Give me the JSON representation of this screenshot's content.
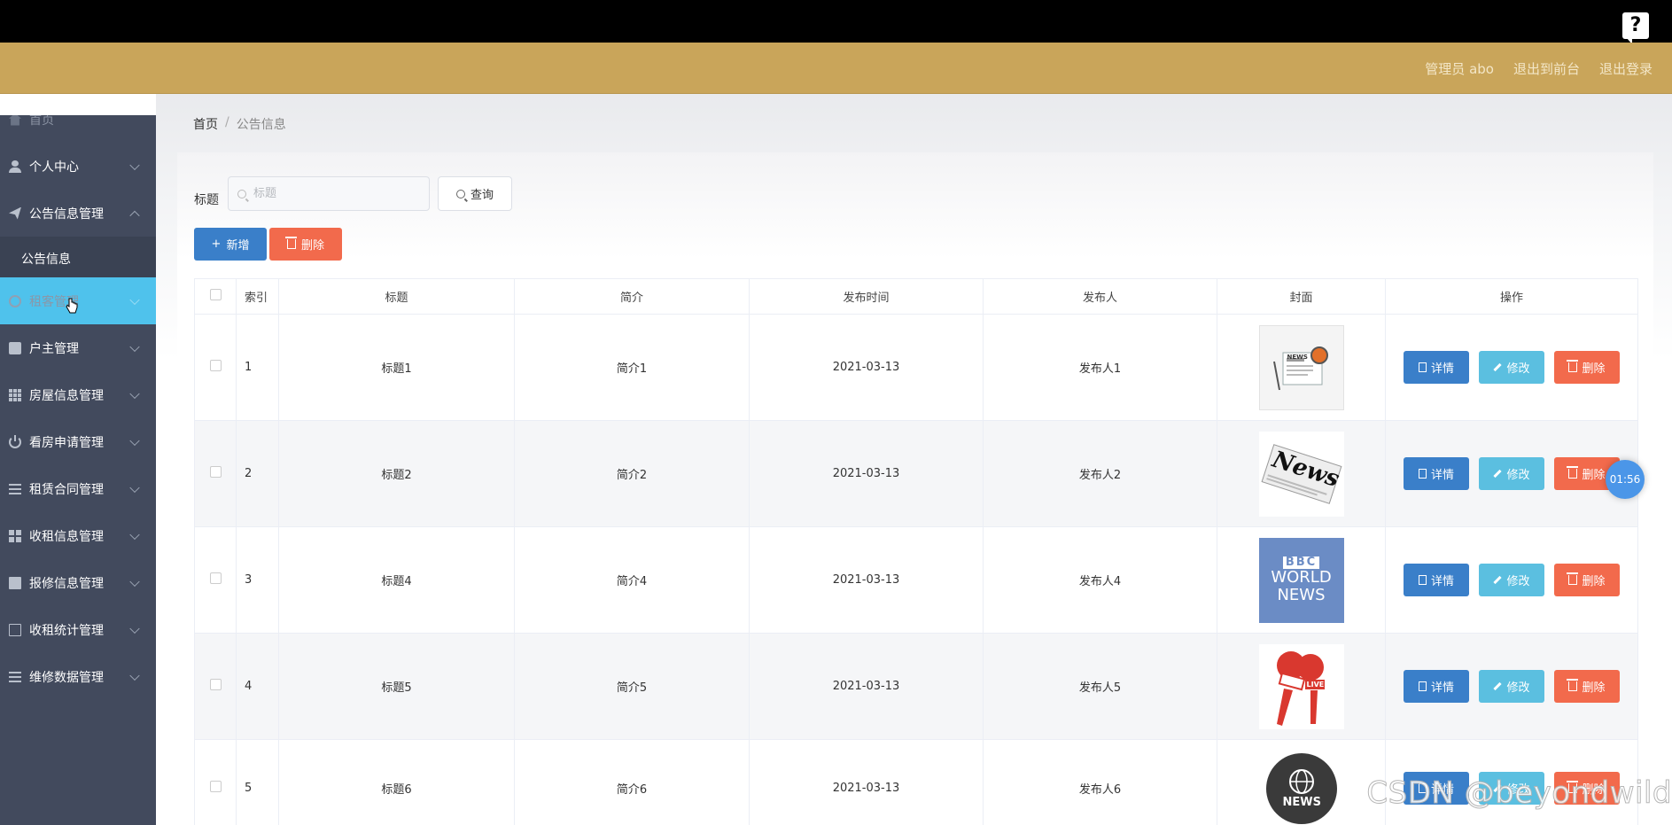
{
  "header": {
    "help_glyph": "?",
    "admin_label": "管理员 abo",
    "back_to_front": "退出到前台",
    "logout": "退出登录"
  },
  "sidebar": {
    "items": [
      {
        "label": "首页",
        "icon": "home-icon"
      },
      {
        "label": "个人中心",
        "icon": "user-icon"
      },
      {
        "label": "公告信息管理",
        "icon": "send-icon"
      },
      {
        "label": "公告信息",
        "icon": ""
      },
      {
        "label": "租客管理",
        "icon": "circle-icon"
      },
      {
        "label": "户主管理",
        "icon": "box-icon"
      },
      {
        "label": "房屋信息管理",
        "icon": "grid-icon"
      },
      {
        "label": "看房申请管理",
        "icon": "power-icon"
      },
      {
        "label": "租赁合同管理",
        "icon": "list-icon"
      },
      {
        "label": "收租信息管理",
        "icon": "apps-icon"
      },
      {
        "label": "报修信息管理",
        "icon": "clipboard-icon"
      },
      {
        "label": "收租统计管理",
        "icon": "card-icon"
      },
      {
        "label": "维修数据管理",
        "icon": "list-icon"
      }
    ]
  },
  "breadcrumb": {
    "home": "首页",
    "separator": "/",
    "current": "公告信息"
  },
  "search": {
    "label": "标题",
    "placeholder": "标题",
    "query_label": "查询"
  },
  "toolbar": {
    "add_label": "新增",
    "add_glyph": "+",
    "delete_label": "删除"
  },
  "table": {
    "columns": [
      "索引",
      "标题",
      "简介",
      "发布时间",
      "发布人",
      "封面",
      "操作"
    ],
    "rows": [
      {
        "index": "1",
        "title": "标题1",
        "intro": "简介1",
        "time": "2021-03-13",
        "publisher": "发布人1",
        "cover": "news-illustration"
      },
      {
        "index": "2",
        "title": "标题2",
        "intro": "简介2",
        "time": "2021-03-13",
        "publisher": "发布人2",
        "cover": "news-newspaper"
      },
      {
        "index": "3",
        "title": "标题4",
        "intro": "简介4",
        "time": "2021-03-13",
        "publisher": "发布人4",
        "cover": "bbc-world-news"
      },
      {
        "index": "4",
        "title": "标题5",
        "intro": "简介5",
        "time": "2021-03-13",
        "publisher": "发布人5",
        "cover": "live-microphones"
      },
      {
        "index": "5",
        "title": "标题6",
        "intro": "简介6",
        "time": "2021-03-13",
        "publisher": "发布人6",
        "cover": "news-globe"
      }
    ],
    "actions": {
      "detail": "详情",
      "edit": "修改",
      "delete": "删除"
    }
  },
  "covers": {
    "c1_text": "NEWS",
    "c2_text": "News",
    "c3_line1": "BBC",
    "c3_line2": "WORLD",
    "c3_line3": "NEWS",
    "c4_text": "LIVE",
    "c5_text": "NEWS"
  },
  "overlay": {
    "timer": "01:56",
    "watermark": "CSDN @beyondwild"
  },
  "colors": {
    "header_gold": "#c9a55a",
    "sidebar_bg": "#424a5d",
    "sidebar_active": "#4fc2ec",
    "primary_blue": "#3a7fc9",
    "info_cyan": "#5bbfe0",
    "danger_red": "#f26a4c"
  }
}
